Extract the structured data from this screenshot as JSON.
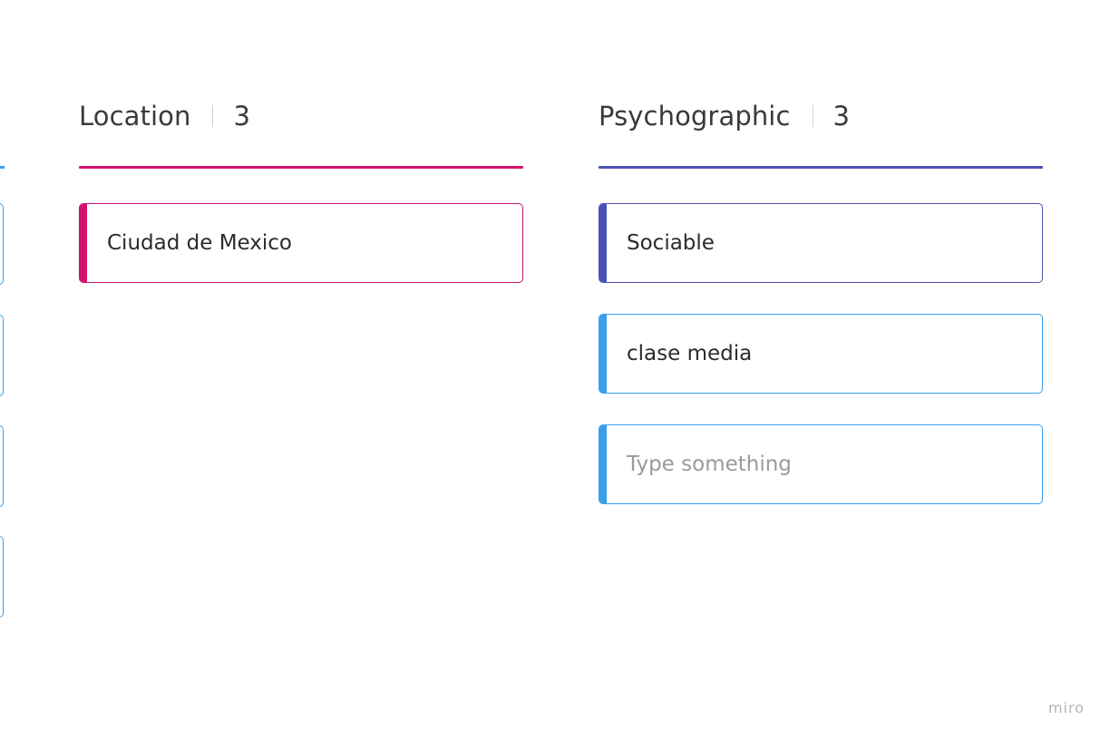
{
  "colors": {
    "location_accent": "#d1126e",
    "psychographic_accent": "#4b52b5",
    "default_accent": "#3a9ee8"
  },
  "location": {
    "title": "Location",
    "count": "3",
    "cards": [
      "Ciudad de Mexico"
    ]
  },
  "psychographic": {
    "title": "Psychographic",
    "count": "3",
    "cards": [
      "Sociable",
      "clase media"
    ],
    "new_card_placeholder": "Type something"
  },
  "watermark": "miro"
}
